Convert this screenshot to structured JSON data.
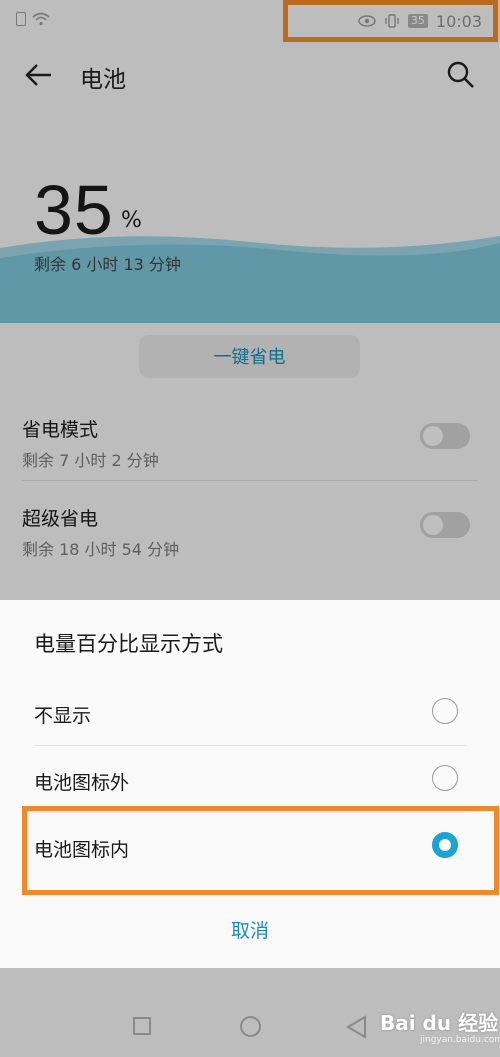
{
  "status_bar": {
    "time": "10:03",
    "battery": "35"
  },
  "header": {
    "title": "电池"
  },
  "battery": {
    "percent": "35",
    "percent_sign": "%",
    "remaining": "剩余 6 小时 13 分钟"
  },
  "one_key_save": "一键省电",
  "settings": [
    {
      "name": "省电模式",
      "sub": "剩余 7 小时 2 分钟",
      "enabled": false
    },
    {
      "name": "超级省电",
      "sub": "剩余 18 小时 54 分钟",
      "enabled": false
    }
  ],
  "dialog": {
    "title": "电量百分比显示方式",
    "options": [
      {
        "label": "不显示",
        "selected": false
      },
      {
        "label": "电池图标外",
        "selected": false
      },
      {
        "label": "电池图标内",
        "selected": true
      }
    ],
    "cancel": "取消"
  },
  "watermark": {
    "brand": "Bai du 经验",
    "url": "jingyan.baidu.com"
  },
  "colors": {
    "accent": "#1aa3d3",
    "highlight": "#f0892a",
    "wave": "#7cc3d6"
  }
}
